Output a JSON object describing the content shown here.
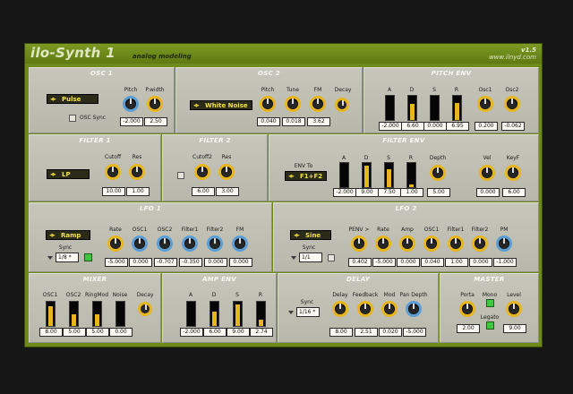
{
  "header": {
    "title": "ilo-Synth 1",
    "subtitle": "analog modeling",
    "version": "v1.5",
    "url": "www.ilnyd.com"
  },
  "osc1": {
    "title": "OSC 1",
    "waveform": "Pulse",
    "osc_sync_label": "OSC Sync",
    "pitch": {
      "label": "Pitch",
      "value": "-2.000"
    },
    "pwidth": {
      "label": "P.width",
      "value": "2.50"
    }
  },
  "osc2": {
    "title": "OSC 2",
    "waveform": "White Noise",
    "pitch": {
      "label": "Pitch",
      "value": "0.040"
    },
    "tune": {
      "label": "Tune",
      "value": "0.018"
    },
    "fm": {
      "label": "FM",
      "value": "3.62"
    },
    "decay": {
      "label": "Decay"
    }
  },
  "pitch_env": {
    "title": "PITCH ENV",
    "a": {
      "label": "A",
      "value": "-2.000",
      "level": 0.0
    },
    "d": {
      "label": "D",
      "value": "6.60",
      "level": 0.66
    },
    "s": {
      "label": "S",
      "value": "0.000",
      "level": 0.0
    },
    "r": {
      "label": "R",
      "value": "6.95",
      "level": 0.7
    },
    "osc1": {
      "label": "Osc1",
      "value": "0.200"
    },
    "osc2": {
      "label": "Osc2",
      "value": "-0.062"
    }
  },
  "filter1": {
    "title": "FILTER 1",
    "type": "LP",
    "cutoff": {
      "label": "Cutoff",
      "value": "10.00"
    },
    "res": {
      "label": "Res",
      "value": "1.00"
    }
  },
  "filter2": {
    "title": "FILTER 2",
    "cutoff2": {
      "label": "Cutoff2",
      "value": "6.00"
    },
    "res": {
      "label": "Res",
      "value": "3.00"
    }
  },
  "filter_env": {
    "title": "FILTER ENV",
    "env_to_label": "ENV To",
    "env_to": "F1+F2",
    "a": {
      "label": "A",
      "value": "-2.000",
      "level": 0.0
    },
    "d": {
      "label": "D",
      "value": "9.00",
      "level": 0.9
    },
    "s": {
      "label": "S",
      "value": "7.50",
      "level": 0.75
    },
    "r": {
      "label": "R",
      "value": "1.00",
      "level": 0.1
    },
    "depth": {
      "label": "Depth",
      "value": "5.00"
    },
    "vel": {
      "label": "Vel",
      "value": "0.000"
    },
    "keyf": {
      "label": "KeyF",
      "value": "6.00"
    }
  },
  "lfo1": {
    "title": "LFO 1",
    "waveform": "Ramp",
    "sync_label": "Sync",
    "sync": "1/8 *",
    "rate": {
      "label": "Rate",
      "value": "-5.000"
    },
    "osc1": {
      "label": "OSC1",
      "value": "0.000"
    },
    "osc2": {
      "label": "OSC2",
      "value": "-0.707"
    },
    "filter1": {
      "label": "Filter1",
      "value": "-0.350"
    },
    "filter2": {
      "label": "Filter2",
      "value": "0.000"
    },
    "fm": {
      "label": "FM",
      "value": "0.000"
    }
  },
  "lfo2": {
    "title": "LFO 2",
    "waveform": "Sine",
    "sync_label": "Sync",
    "sync": "1/1",
    "penv": {
      "label": "PENV >",
      "value": "0.402"
    },
    "rate": {
      "label": "Rate",
      "value": "-5.000"
    },
    "amp": {
      "label": "Amp",
      "value": "0.000"
    },
    "osc1": {
      "label": "OSC1",
      "value": "0.040"
    },
    "filter1": {
      "label": "Filter1",
      "value": "1.00"
    },
    "filter2": {
      "label": "Filter2",
      "value": "0.000"
    },
    "pm": {
      "label": "PM",
      "value": "-1.000"
    }
  },
  "mixer": {
    "title": "MIXER",
    "osc1": {
      "label": "OSC1",
      "value": "8.00",
      "level": 0.8
    },
    "osc2": {
      "label": "OSC2",
      "value": "5.00",
      "level": 0.5
    },
    "ringmod": {
      "label": "RingMod",
      "value": "5.00",
      "level": 0.5
    },
    "noise": {
      "label": "Noise",
      "value": "0.00",
      "level": 0.0
    },
    "decay": {
      "label": "Decay"
    }
  },
  "amp_env": {
    "title": "AMP ENV",
    "a": {
      "label": "A",
      "value": "-2.000",
      "level": 0.0
    },
    "d": {
      "label": "D",
      "value": "6.00",
      "level": 0.6
    },
    "s": {
      "label": "S",
      "value": "9.00",
      "level": 0.9
    },
    "r": {
      "label": "R",
      "value": "2.74",
      "level": 0.27
    }
  },
  "delay": {
    "title": "DELAY",
    "sync_label": "Sync",
    "sync": "1/16 *",
    "delay": {
      "label": "Delay",
      "value": "8.00"
    },
    "feedback": {
      "label": "Feedback",
      "value": "2.51"
    },
    "mod": {
      "label": "Mod",
      "value": "0.020"
    },
    "pan_depth": {
      "label": "Pan Depth",
      "value": "-5.000"
    }
  },
  "master": {
    "title": "MASTER",
    "porta": {
      "label": "Porta",
      "value": "2.00"
    },
    "mono_label": "Mono",
    "legato_label": "Legato",
    "level": {
      "label": "Level",
      "value": "9.00"
    }
  }
}
